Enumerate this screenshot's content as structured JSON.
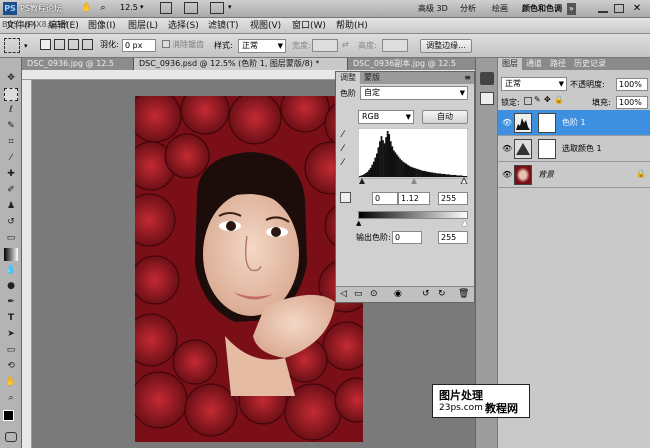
{
  "app": {
    "logo": "PS",
    "watermark_tl": "PS教程论坛",
    "watermark_tl2": "BBS.16XX8.COM",
    "zoom": "12.5",
    "workspaces": [
      "高级 3D",
      "分析",
      "绘画",
      "颜色和色调"
    ],
    "more": "»"
  },
  "menu": [
    "文件(F)",
    "编辑(E)",
    "图像(I)",
    "图层(L)",
    "选择(S)",
    "滤镜(T)",
    "视图(V)",
    "窗口(W)",
    "帮助(H)"
  ],
  "options": {
    "feather_label": "羽化:",
    "feather_value": "0 px",
    "antialias": "消除锯齿",
    "style_label": "样式:",
    "style_value": "正常",
    "width_label": "宽度:",
    "height_label": "高度:",
    "refine_btn": "调整边缘..."
  },
  "tabs": [
    {
      "label": "DSC_0936.jpg @ 12.5"
    },
    {
      "label": "DSC_0936.psd @ 12.5% (色阶 1, 图层蒙版/8) *"
    },
    {
      "label": "DSC_0936副本.jpg @ 12.5"
    }
  ],
  "adjustments": {
    "tabs": [
      "调整",
      "蒙版"
    ],
    "levels_label": "色阶",
    "preset_value": "自定",
    "channel_value": "RGB",
    "auto_btn": "自动",
    "input_black": "0",
    "input_gamma": "1.12",
    "input_white": "255",
    "output_label": "输出色阶:",
    "output_black": "0",
    "output_white": "255",
    "histogram": [
      2,
      3,
      4,
      6,
      8,
      10,
      14,
      18,
      24,
      30,
      38,
      46,
      58,
      70,
      80,
      72,
      66,
      78,
      90,
      84,
      70,
      60,
      52,
      48,
      44,
      40,
      36,
      33,
      30,
      28,
      26,
      24,
      22,
      20,
      19,
      18,
      17,
      16,
      15,
      14,
      13,
      12,
      12,
      11,
      10,
      10,
      9,
      9,
      8,
      8,
      7,
      7,
      7,
      6,
      6,
      6,
      5,
      5,
      5,
      4,
      4,
      4,
      4,
      3,
      3,
      3,
      3,
      2,
      2,
      2
    ]
  },
  "layers_panel": {
    "tabs": [
      "图层",
      "通道",
      "路径",
      "历史记录"
    ],
    "blend_mode": "正常",
    "opacity_label": "不透明度:",
    "opacity_value": "100%",
    "lock_label": "锁定:",
    "fill_label": "填充:",
    "fill_value": "100%",
    "layers": [
      {
        "name": "色阶 1",
        "selected": true
      },
      {
        "name": "选取颜色 1",
        "selected": false
      },
      {
        "name": "背景",
        "selected": false
      }
    ]
  },
  "watermark": {
    "line1": "图片处理",
    "line2": "23ps.com",
    "line3": "教程网"
  }
}
